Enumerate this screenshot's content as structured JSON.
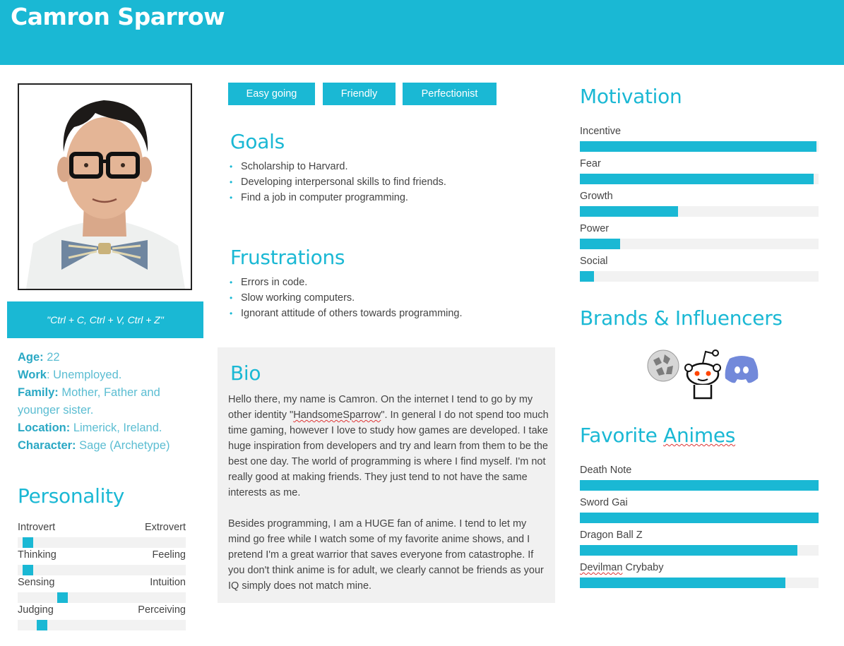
{
  "header": {
    "name": "Camron Sparrow"
  },
  "profile": {
    "quote": "\"Ctrl + C, Ctrl + V, Ctrl + Z\"",
    "facts": [
      {
        "label": "Age:",
        "value": " 22"
      },
      {
        "label": "Work",
        "value": ": Unemployed."
      },
      {
        "label": "Family:",
        "value": " Mother, Father and younger sister."
      },
      {
        "label": "Location:",
        "value": " Limerick, Ireland."
      },
      {
        "label": "Character:",
        "value": " Sage (Archetype)"
      }
    ]
  },
  "personality": {
    "title": "Personality",
    "traits": [
      {
        "left": "Introvert",
        "right": "Extrovert",
        "level": 0.03
      },
      {
        "left": "Thinking",
        "right": "Feeling",
        "level": 0.03
      },
      {
        "left": "Sensing",
        "right": "Intuition",
        "level": 0.25
      },
      {
        "left": "Judging",
        "right": "Perceiving",
        "level": 0.12
      }
    ]
  },
  "tags": [
    "Easy going",
    "Friendly",
    "Perfectionist"
  ],
  "goals": {
    "title": "Goals",
    "items": [
      "Scholarship to Harvard.",
      "Developing interpersonal skills to find friends.",
      "Find a job in computer programming."
    ]
  },
  "frustrations": {
    "title": "Frustrations",
    "items": [
      "Errors in code.",
      "Slow working computers.",
      "Ignorant attitude of others towards programming."
    ]
  },
  "bio": {
    "title": "Bio",
    "p1_before": "Hello there, my name is Camron. On the internet I tend to go by my other identity \"",
    "p1_handle": "HandsomeSparrow",
    "p1_after": "\". In general I do not spend too much time gaming, however I love to study how games are developed. I take huge inspiration from developers and try and learn from them to be the best one day. The world of programming is where I find myself. I'm not really good at making friends. They just tend to not have the same interests as me.",
    "p2": "Besides programming, I am a HUGE fan of anime. I tend to let my mind go free while I watch some of my favorite anime shows, and I pretend I'm a great warrior that saves everyone from catastrophe. If you don't think anime is for adult, we clearly cannot be friends as your IQ simply does not match mine."
  },
  "motivation": {
    "title": "Motivation",
    "items": [
      {
        "label": "Incentive",
        "level": 0.99
      },
      {
        "label": "Fear",
        "level": 0.98
      },
      {
        "label": "Growth",
        "level": 0.41
      },
      {
        "label": "Power",
        "level": 0.17
      },
      {
        "label": "Social",
        "level": 0.06
      }
    ]
  },
  "brands": {
    "title": "Brands & Influencers",
    "logos": [
      "wikipedia-logo",
      "reddit-logo",
      "discord-logo"
    ]
  },
  "animes": {
    "title_prefix": "Favorite ",
    "title_word": "Animes",
    "items": [
      {
        "label_a": "",
        "label_b": "Death Note",
        "level": 1.0
      },
      {
        "label_a": "",
        "label_b": "Sword Gai",
        "level": 1.0
      },
      {
        "label_a": "",
        "label_b": "Dragon Ball Z",
        "level": 0.91
      },
      {
        "label_a": "Devilman",
        "label_b": " Crybaby",
        "level": 0.86
      }
    ]
  },
  "colors": {
    "accent": "#1ab8d4",
    "track": "#f2f2f2",
    "bio_bg": "#f1f1f1"
  }
}
